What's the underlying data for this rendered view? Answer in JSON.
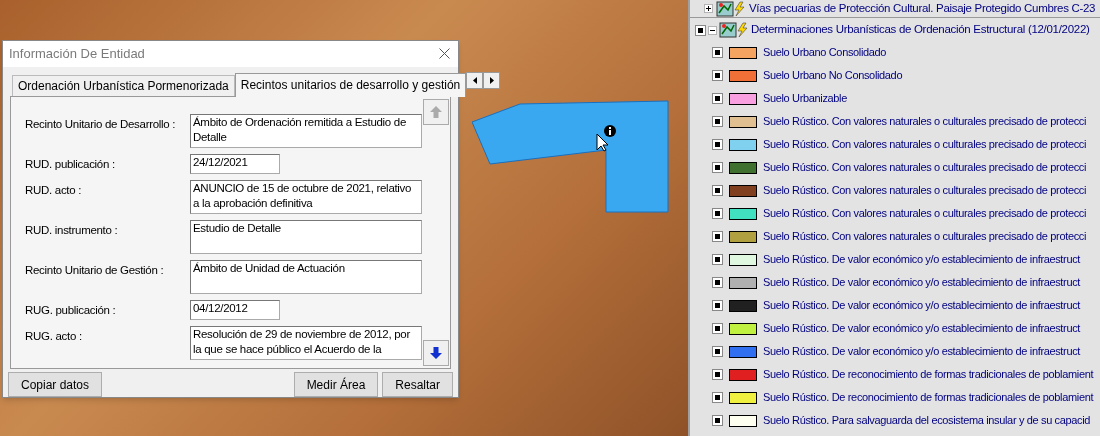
{
  "dialog": {
    "title": "Información De Entidad",
    "tabs": [
      {
        "label": "Ordenación Urbanística Pormenorizada",
        "selected": false
      },
      {
        "label": "Recintos unitarios de desarrollo y gestión",
        "selected": true
      }
    ],
    "fields": [
      {
        "label": "Recinto Unitario de Desarrollo :",
        "kind": "text",
        "value": "Ámbito de Ordenación remitida a Estudio de Detalle"
      },
      {
        "label": "RUD. publicación :",
        "kind": "date",
        "value": "24/12/2021"
      },
      {
        "label": "RUD. acto :",
        "kind": "text",
        "value": "ANUNCIO de 15 de octubre de 2021, relativo a la aprobación definitiva"
      },
      {
        "label": "RUD. instrumento :",
        "kind": "text",
        "value": "Estudio de Detalle"
      },
      {
        "label": "Recinto Unitario de Gestión :",
        "kind": "text",
        "value": "Ámbito de Unidad de Actuación"
      },
      {
        "label": "RUG. publicación :",
        "kind": "date",
        "value": "04/12/2012"
      },
      {
        "label": "RUG. acto :",
        "kind": "text",
        "value": "Resolución de 29 de noviembre de 2012, por la que se hace público el Acuerdo de la"
      }
    ],
    "scroll_up": {
      "disabled": true
    },
    "scroll_down": {
      "disabled": false
    },
    "buttons_left": [
      "Copiar datos"
    ],
    "buttons_right": [
      "Medir Área",
      "Resaltar"
    ]
  },
  "layers": {
    "top_layer": {
      "label": "Vías pecuarias de Protección Cultural. Paisaje Protegido Cumbres C-23",
      "expanded": false
    },
    "group": {
      "label": "Determinaciones Urbanísticas de Ordenación Estructural (12/01/2022)",
      "expanded": true,
      "checked": true
    },
    "legend": [
      {
        "label": "Suelo Urbano Consolidado",
        "color": "#f4a460",
        "checked": true
      },
      {
        "label": "Suelo Urbano No Consolidado",
        "color": "#f07038",
        "checked": true
      },
      {
        "label": "Suelo Urbanizable",
        "color": "#f8a0e0",
        "checked": true
      },
      {
        "label": "Suelo Rústico. Con valores naturales o culturales precisado  de protecci",
        "color": "#e0c090",
        "checked": true
      },
      {
        "label": "Suelo Rústico. Con valores naturales o culturales precisado  de protecci",
        "color": "#80d0f0",
        "checked": true
      },
      {
        "label": "Suelo Rústico. Con valores naturales o culturales precisado  de protecci",
        "color": "#407030",
        "checked": true
      },
      {
        "label": "Suelo Rústico. Con valores naturales o culturales precisado  de protecci",
        "color": "#804020",
        "checked": true
      },
      {
        "label": "Suelo Rústico. Con valores naturales o culturales precisado  de protecci",
        "color": "#40e0c0",
        "checked": true
      },
      {
        "label": "Suelo Rústico. Con valores naturales o culturales precisado  de protecci",
        "color": "#b0a040",
        "checked": true
      },
      {
        "label": "Suelo Rústico. De  valor económico y/o  establecimiento de infraestruct",
        "color": "#e0f8e0",
        "checked": true
      },
      {
        "label": "Suelo Rústico. De  valor económico y/o  establecimiento de infraestruct",
        "color": "#b0b0b0",
        "checked": true
      },
      {
        "label": "Suelo Rústico. De  valor económico y/o  establecimiento de infraestruct",
        "color": "#202020",
        "checked": true
      },
      {
        "label": "Suelo Rústico. De  valor económico y/o  establecimiento de infraestruct",
        "color": "#c0f040",
        "checked": true
      },
      {
        "label": "Suelo Rústico. De  valor económico y/o  establecimiento de infraestruct",
        "color": "#3070f0",
        "checked": true
      },
      {
        "label": "Suelo Rústico. De reconocimiento de formas tradicionales de poblamient",
        "color": "#e02020",
        "checked": true
      },
      {
        "label": "Suelo Rústico. De reconocimiento de formas tradicionales de poblamient",
        "color": "#f0f040",
        "checked": true
      },
      {
        "label": "Suelo Rústico. Para salvaguarda del ecosistema insular y de  su capacid",
        "color": "#fffff0",
        "checked": true
      }
    ]
  }
}
